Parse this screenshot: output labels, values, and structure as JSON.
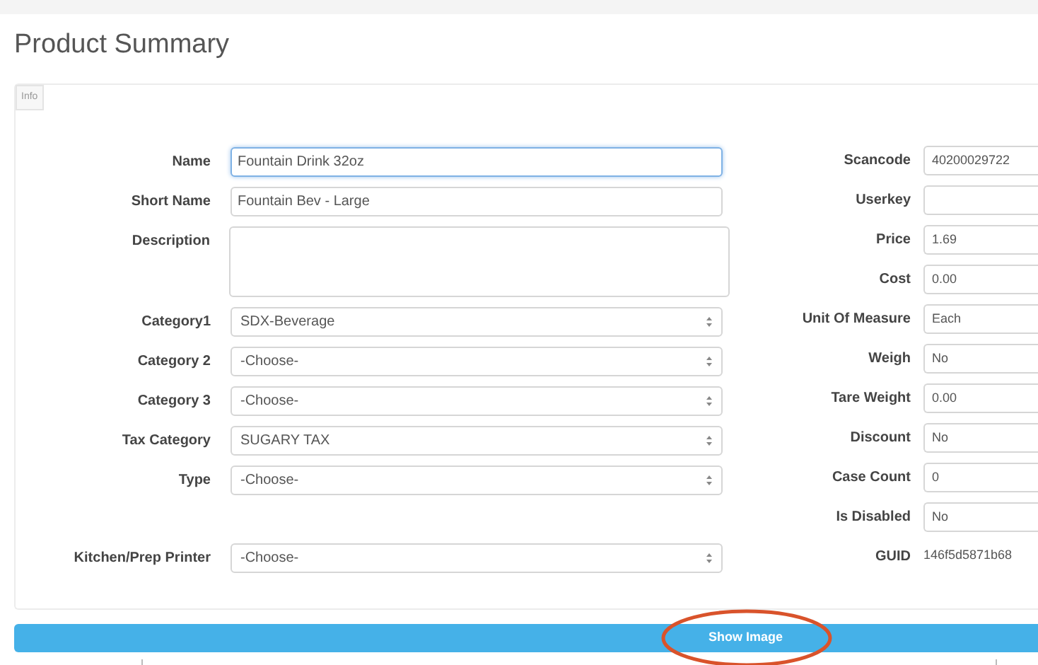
{
  "title": "Product Summary",
  "tabs": [
    {
      "label": "Info",
      "selected": true
    }
  ],
  "left_fields": [
    {
      "label": "Name",
      "kind": "text",
      "value": "Fountain Drink 32oz",
      "focused": true
    },
    {
      "label": "Short Name",
      "kind": "text",
      "value": "Fountain Bev - Large",
      "focused": false
    },
    {
      "label": "Description",
      "kind": "textarea",
      "focused": false
    },
    {
      "label": "Category1",
      "kind": "select",
      "value": "SDX-Beverage",
      "focused": false
    },
    {
      "label": "Category 2",
      "kind": "select",
      "value": "-Choose-",
      "focused": false
    },
    {
      "label": "Category 3",
      "kind": "select",
      "value": "-Choose-",
      "focused": false
    },
    {
      "label": "Tax Category",
      "kind": "select",
      "value": "SUGARY TAX",
      "focused": false
    },
    {
      "label": "Type",
      "kind": "select",
      "value": "-Choose-",
      "focused": false
    },
    {
      "kind": "spacer"
    },
    {
      "label": "Kitchen/Prep Printer",
      "kind": "select",
      "value": "-Choose-",
      "focused": false
    }
  ],
  "right_fields": [
    {
      "label": "Scancode",
      "kind": "text",
      "value": "40200029722"
    },
    {
      "label": "Userkey",
      "kind": "text"
    },
    {
      "label": "Price",
      "kind": "text",
      "value": "1.69"
    },
    {
      "label": "Cost",
      "kind": "text",
      "value": "0.00"
    },
    {
      "label": "Unit Of Measure",
      "kind": "text",
      "value": "Each"
    },
    {
      "label": "Weigh",
      "kind": "text",
      "value": "No"
    },
    {
      "label": "Tare Weight",
      "kind": "text",
      "value": "0.00"
    },
    {
      "label": "Discount",
      "kind": "text",
      "value": "No"
    },
    {
      "label": "Case Count",
      "kind": "text",
      "value": "0"
    },
    {
      "label": "Is Disabled",
      "kind": "text",
      "value": "No"
    },
    {
      "label": "GUID",
      "kind": "static",
      "value": "146f5d5871b68"
    }
  ],
  "show_image_button": {
    "label": "Show Image",
    "circled": true
  }
}
